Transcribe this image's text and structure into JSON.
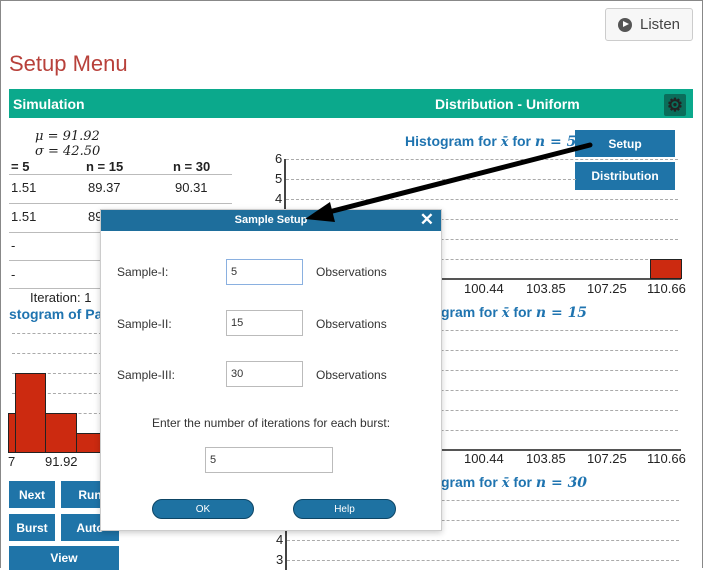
{
  "listen": {
    "label": "Listen",
    "icon": "play-icon"
  },
  "page_title": "Setup Menu",
  "header": {
    "left": "Simulation",
    "right": "Distribution - Uniform",
    "gear_icon": "gear-icon",
    "color": "#0ba98c"
  },
  "stats": {
    "mu": "μ = 91.92",
    "sigma": "σ = 42.50"
  },
  "table": {
    "headers": [
      "= 5",
      "n = 15",
      "n = 30"
    ],
    "rows": [
      [
        "1.51",
        "89.37",
        "90.31"
      ],
      [
        "1.51",
        "89",
        ""
      ],
      [
        "-",
        "",
        ""
      ],
      [
        "-",
        "",
        ""
      ]
    ]
  },
  "iteration": "Iteration: 1",
  "parent_hist": {
    "title": "stogram of Par",
    "xlabels": [
      "7",
      "91.92"
    ]
  },
  "buttons": {
    "next": "Next",
    "run": "Run",
    "burst": "Burst",
    "auto": "Auto",
    "view": "View",
    "setup": "Setup",
    "distribution": "Distribution"
  },
  "hist1": {
    "title_pre": "Histogram for ",
    "xbar": "x̄",
    "title_mid": " for ",
    "n": "n = 5",
    "yticks": [
      "6",
      "5",
      "4"
    ],
    "xlabels": [
      "100.44",
      "103.85",
      "107.25",
      "110.66"
    ]
  },
  "hist2": {
    "title_pre": "gram for ",
    "xbar": "x̄",
    "title_mid": " for ",
    "n": "n = 15",
    "xlabels": [
      "100.44",
      "103.85",
      "107.25",
      "110.66"
    ]
  },
  "hist3": {
    "title_pre": "gram for ",
    "xbar": "x̄",
    "title_mid": " for ",
    "n": "n = 30",
    "yticks": [
      "4",
      "3"
    ]
  },
  "dialog": {
    "title": "Sample Setup",
    "close_icon": "close-icon",
    "rows": [
      {
        "label": "Sample-I:",
        "value": "5",
        "unit": "Observations"
      },
      {
        "label": "Sample-II:",
        "value": "15",
        "unit": "Observations"
      },
      {
        "label": "Sample-III:",
        "value": "30",
        "unit": "Observations"
      }
    ],
    "iter_label": "Enter the number of iterations for each burst:",
    "iter_value": "5",
    "ok": "OK",
    "help": "Help"
  },
  "colors": {
    "title": "#b8413b",
    "button": "#1f74a8",
    "bar": "#cc2a10"
  }
}
